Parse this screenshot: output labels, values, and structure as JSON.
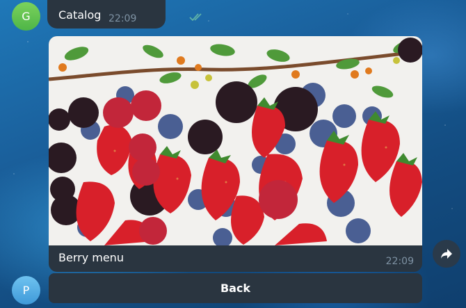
{
  "top_message": {
    "sender_initial": "G",
    "text": "Catalog",
    "time": "22:09"
  },
  "media_message": {
    "caption": "Berry menu",
    "time": "22:09",
    "image": "photo of strawberries, raspberries, blackberries and blueberries on a white background"
  },
  "user_initial": "P",
  "keyboard": {
    "back_label": "Back"
  },
  "icons": {
    "read_status": "double-check-icon",
    "forward": "forward-arrow-icon"
  },
  "colors": {
    "bubble": "#2a3540",
    "read_check": "#5fb3a8",
    "avatar_g": "#5bbf4e",
    "avatar_p": "#4aa6e0"
  }
}
